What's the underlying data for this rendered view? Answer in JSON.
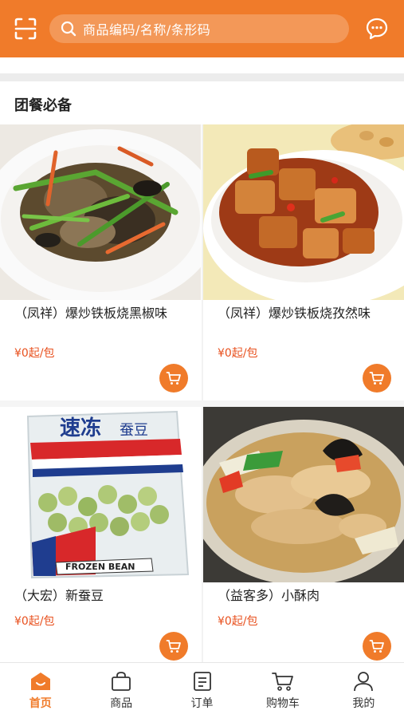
{
  "header": {
    "search_placeholder": "商品编码/名称/条形码",
    "icons": {
      "scan": "scan-icon",
      "search": "search-icon",
      "message": "message-icon"
    }
  },
  "section": {
    "title": "团餐必备"
  },
  "products": [
    {
      "name": "（凤祥）爆炒铁板烧黑椒味",
      "price": "¥0起/包",
      "image": "stir-fried-chicken-with-greens"
    },
    {
      "name": "（凤祥）爆炒铁板烧孜然味",
      "price": "¥0起/包",
      "image": "spicy-fried-chicken-dish"
    },
    {
      "name": "（大宏）新蚕豆",
      "price": "¥0起/包",
      "image": "frozen-broad-beans-bag",
      "package_text": {
        "brand": "速冻",
        "item": "蚕豆",
        "english": "FROZEN BEAN"
      }
    },
    {
      "name": "（益客多）小酥肉",
      "price": "¥0起/包",
      "image": "pork-with-wood-ear-mushroom"
    }
  ],
  "tabbar": {
    "items": [
      {
        "label": "首页",
        "icon": "home-icon",
        "active": true
      },
      {
        "label": "商品",
        "icon": "bag-icon",
        "active": false
      },
      {
        "label": "订单",
        "icon": "order-icon",
        "active": false
      },
      {
        "label": "购物车",
        "icon": "cart-icon",
        "active": false
      },
      {
        "label": "我的",
        "icon": "user-icon",
        "active": false
      }
    ]
  },
  "colors": {
    "accent": "#f07b2a",
    "price": "#e8501e"
  }
}
